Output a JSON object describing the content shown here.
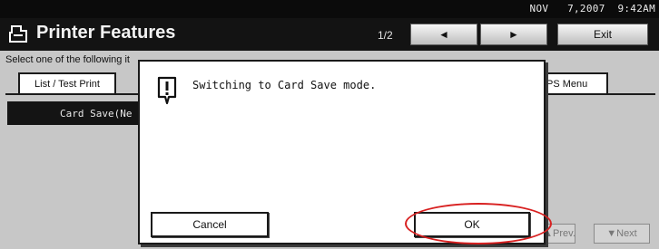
{
  "status_bar": {
    "date": "NOV   7,2007  9:42AM"
  },
  "header": {
    "title": "Printer Features",
    "page_indicator": "1/2",
    "prev_label": "◄",
    "next_label": "►",
    "exit_label": "Exit"
  },
  "main": {
    "instruction": "Select one of the following it",
    "tabs": [
      {
        "label": "List / Test Print"
      },
      {
        "label": "PS Menu"
      }
    ],
    "selected_item": "Card Save(Ne",
    "prev_page_label": "▲Prev.",
    "next_page_label": "▼Next"
  },
  "dialog": {
    "message": "Switching to Card Save mode.",
    "cancel_label": "Cancel",
    "ok_label": "OK"
  },
  "colors": {
    "header_bg": "#131313",
    "highlight": "#d82020"
  }
}
